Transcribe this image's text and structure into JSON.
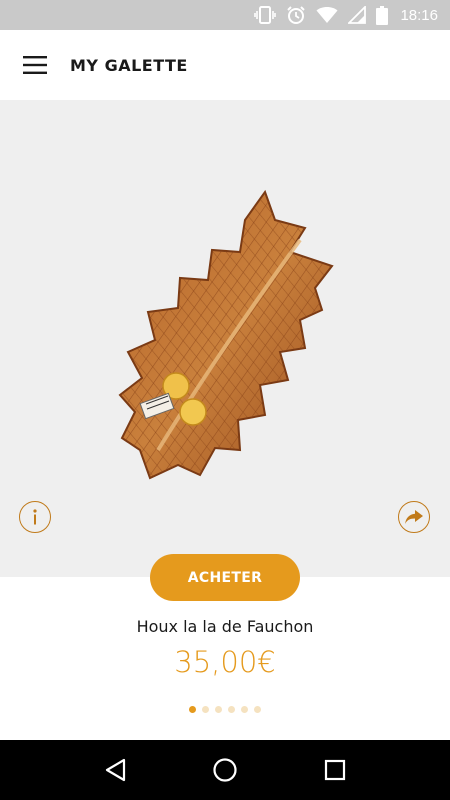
{
  "status_bar": {
    "time": "18:16",
    "icons": [
      "vibrate-icon",
      "alarm-icon",
      "wifi-icon",
      "signal-icon",
      "battery-icon"
    ]
  },
  "app_bar": {
    "title": "MY GALETTE",
    "menu_icon": "hamburger-menu-icon"
  },
  "hero": {
    "image_subject": "holly-leaf-shaped galette with golden pastry decorations",
    "info_icon": "info-icon",
    "share_icon": "share-icon"
  },
  "product": {
    "buy_label": "ACHETER",
    "name": "Houx la la de Fauchon",
    "price": "35,00€"
  },
  "pager": {
    "count": 6,
    "active_index": 0
  },
  "nav_bar": {
    "icons": [
      "back-icon",
      "home-icon",
      "recents-icon"
    ]
  },
  "colors": {
    "accent": "#e59a1d",
    "status_bar": "#c9c9c9",
    "hero_background": "#efefef",
    "nav_bar": "#000000",
    "icon_outline": "#c07a1a"
  }
}
